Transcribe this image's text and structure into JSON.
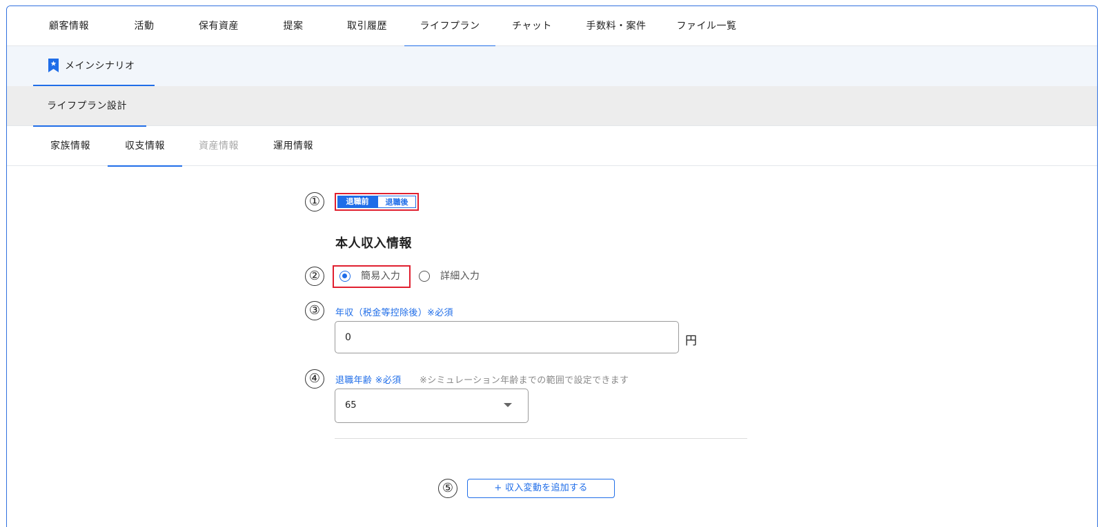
{
  "top_tabs": {
    "items": [
      {
        "label": "顧客情報"
      },
      {
        "label": "活動"
      },
      {
        "label": "保有資産"
      },
      {
        "label": "提案"
      },
      {
        "label": "取引履歴"
      },
      {
        "label": "ライフプラン"
      },
      {
        "label": "チャット"
      },
      {
        "label": "手数料・案件"
      },
      {
        "label": "ファイル一覧"
      }
    ],
    "active": "ライフプラン"
  },
  "scenario": {
    "label": "メインシナリオ",
    "icon": "bookmark-star-icon"
  },
  "design_tab": {
    "label": "ライフプラン設計"
  },
  "sub_tabs": {
    "items": [
      {
        "label": "家族情報"
      },
      {
        "label": "収支情報"
      },
      {
        "label": "資産情報"
      },
      {
        "label": "運用情報"
      }
    ],
    "active": "収支情報",
    "disabled": "資産情報"
  },
  "markers": [
    "①",
    "②",
    "③",
    "④",
    "⑤"
  ],
  "period_toggle": {
    "options": [
      "退職前",
      "退職後"
    ],
    "selected": "退職前"
  },
  "section_title": "本人収入情報",
  "input_mode": {
    "options": [
      "簡易入力",
      "詳細入力"
    ],
    "selected": "簡易入力"
  },
  "annual_income": {
    "label": "年収（税金等控除後）※必須",
    "value": "0",
    "unit": "円"
  },
  "retirement_age": {
    "label": "退職年齢 ※必須",
    "note": "※シミュレーション年齢までの範囲で設定できます",
    "value": "65"
  },
  "add_button": {
    "label": "+ 収入変動を追加する"
  },
  "colors": {
    "accent": "#1f6de8",
    "highlight": "#e01e2e",
    "scenario_bg": "#f2f6fb",
    "design_bg": "#ededed",
    "disabled_text": "#a8a8a8"
  }
}
